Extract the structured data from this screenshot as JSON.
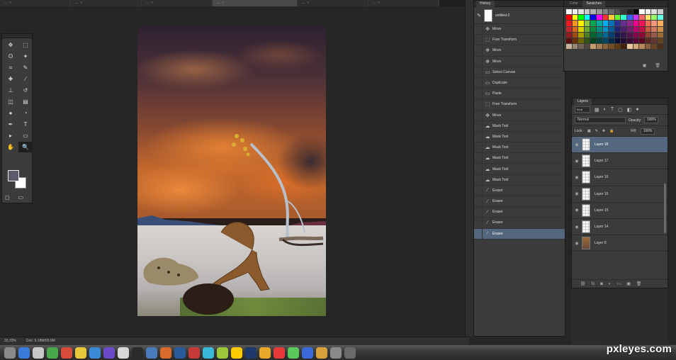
{
  "tabs": [
    {
      "label": "...",
      "active": false
    },
    {
      "label": "...",
      "active": false
    },
    {
      "label": "...",
      "active": false
    },
    {
      "label": "...",
      "active": true
    },
    {
      "label": "...",
      "active": false
    },
    {
      "label": "...",
      "active": false
    }
  ],
  "tools": [
    "move",
    "marquee",
    "lasso",
    "magic-wand",
    "crop",
    "eyedropper",
    "healing",
    "brush",
    "stamp",
    "history-brush",
    "eraser",
    "gradient",
    "blur",
    "dodge",
    "pen",
    "type",
    "path-select",
    "shape",
    "hand",
    "zoom"
  ],
  "history": {
    "tab_label": "History",
    "snapshot_label": "untitled-2",
    "items": [
      {
        "icon": "move",
        "label": "Move",
        "active": false
      },
      {
        "icon": "transform",
        "label": "Free Transform",
        "active": false
      },
      {
        "icon": "move",
        "label": "Move",
        "active": false
      },
      {
        "icon": "move",
        "label": "Move",
        "active": false
      },
      {
        "icon": "layer",
        "label": "Select Canvas",
        "active": false
      },
      {
        "icon": "layer",
        "label": "Duplicate",
        "active": false
      },
      {
        "icon": "layer",
        "label": "Paste",
        "active": false
      },
      {
        "icon": "transform",
        "label": "Free Transform",
        "active": false
      },
      {
        "icon": "move",
        "label": "Move",
        "active": false
      },
      {
        "icon": "lasso",
        "label": "Mask Tool",
        "active": false
      },
      {
        "icon": "lasso",
        "label": "Mask Tool",
        "active": false
      },
      {
        "icon": "lasso",
        "label": "Mask Tool",
        "active": false
      },
      {
        "icon": "lasso",
        "label": "Mask Tool",
        "active": false
      },
      {
        "icon": "lasso",
        "label": "Mask Tool",
        "active": false
      },
      {
        "icon": "lasso",
        "label": "Mask Tool",
        "active": false
      },
      {
        "icon": "brush",
        "label": "Eraser",
        "active": false
      },
      {
        "icon": "brush",
        "label": "Eraser",
        "active": false
      },
      {
        "icon": "brush",
        "label": "Eraser",
        "active": false
      },
      {
        "icon": "brush",
        "label": "Eraser",
        "active": false
      },
      {
        "icon": "brush",
        "label": "Eraser",
        "active": true
      }
    ]
  },
  "color_panel": {
    "tabs": [
      "Color",
      "Swatches"
    ],
    "swatch_colors": [
      "#ffffff",
      "#f0f0f0",
      "#e0e0e0",
      "#c8c8c8",
      "#b0b0b0",
      "#989898",
      "#808080",
      "#686868",
      "#505050",
      "#383838",
      "#202020",
      "#000000",
      "#ffffff",
      "#eeeeee",
      "#dddddd",
      "#cccccc",
      "#ff0000",
      "#ffff00",
      "#00ff00",
      "#00ffff",
      "#0000ff",
      "#ff00ff",
      "#ff3333",
      "#ffcc33",
      "#66ff33",
      "#33ffcc",
      "#3366ff",
      "#cc33ff",
      "#ff6666",
      "#ffe066",
      "#99ff66",
      "#66ffe0",
      "#ed1c24",
      "#f7941d",
      "#fff200",
      "#8dc63f",
      "#00a651",
      "#00a99d",
      "#00aeef",
      "#0072bc",
      "#2e3192",
      "#662d91",
      "#92278f",
      "#ec008c",
      "#ed145b",
      "#f26c4f",
      "#f69679",
      "#fbaf5d",
      "#c1272d",
      "#d86a16",
      "#dcd400",
      "#6aa82e",
      "#008a3f",
      "#008c80",
      "#0090c8",
      "#005b9a",
      "#1f2270",
      "#4c1f6e",
      "#741e6e",
      "#c00070",
      "#c00e48",
      "#c85a40",
      "#d07a60",
      "#d09048",
      "#8f1a20",
      "#a04e10",
      "#a89e00",
      "#4e7e22",
      "#00672e",
      "#00675e",
      "#006a94",
      "#003f6e",
      "#141650",
      "#361450",
      "#541450",
      "#8a0050",
      "#8a0a34",
      "#924030",
      "#9a5848",
      "#9a6a34",
      "#5a0e12",
      "#6a3208",
      "#6e6600",
      "#325214",
      "#00421c",
      "#00423c",
      "#00445e",
      "#002846",
      "#0a0c32",
      "#220a32",
      "#360a32",
      "#58003a",
      "#580620",
      "#5e2a20",
      "#64382e",
      "#644420",
      "#c7b299",
      "#998675",
      "#736357",
      "#534741",
      "#c69c6d",
      "#a67c52",
      "#8c6239",
      "#754c24",
      "#603913",
      "#42210b",
      "#e6c7a0",
      "#d3a878",
      "#b8875a",
      "#8b5e3c",
      "#6b4226",
      "#4d2e1a"
    ]
  },
  "layers": {
    "tab_label": "Layers",
    "filter_kind": "Kind",
    "blend_mode": "Normal",
    "opacity_label": "Opacity:",
    "opacity_value": "100%",
    "lock_label": "Lock:",
    "fill_label": "Fill:",
    "fill_value": "100%",
    "items": [
      {
        "name": "Layer 18",
        "thumb": "transparent",
        "active": true
      },
      {
        "name": "Layer 17",
        "thumb": "transparent",
        "active": false
      },
      {
        "name": "Layer 16",
        "thumb": "transparent",
        "active": false
      },
      {
        "name": "Layer 15",
        "thumb": "transparent",
        "active": false
      },
      {
        "name": "Layer 15",
        "thumb": "transparent",
        "active": false
      },
      {
        "name": "Layer 14",
        "thumb": "transparent",
        "active": false
      },
      {
        "name": "Layer 8",
        "thumb": "picture",
        "active": false
      }
    ]
  },
  "status": {
    "zoom": "33.33%",
    "doc": "Doc: 6.18M/99.9M"
  },
  "watermark": "pxleyes.com",
  "colors": {
    "workspace": "#262626",
    "panel": "#3b3b3b",
    "selection": "#55677e"
  }
}
